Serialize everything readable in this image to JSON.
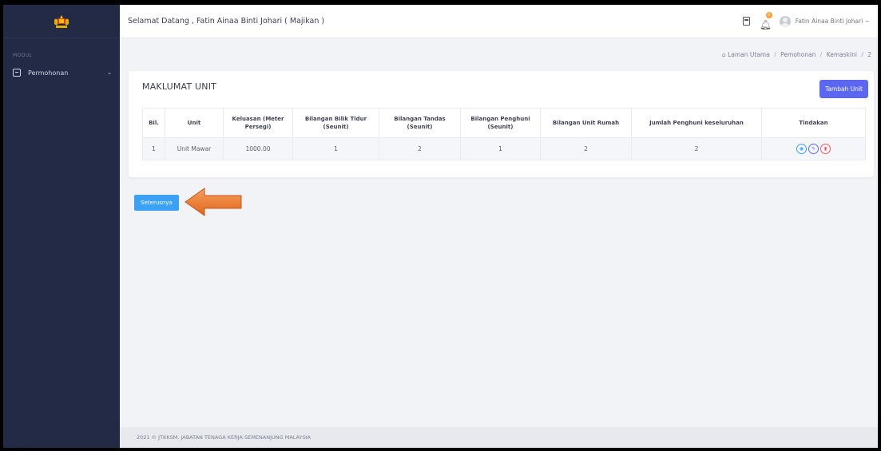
{
  "sidebar": {
    "section_label": "MODUL",
    "items": [
      {
        "label": "Permohonan",
        "icon": "clipboard-icon"
      }
    ]
  },
  "topbar": {
    "welcome": "Selamat Datang , Fatin Ainaa Binti Johari ( Majikan )",
    "notification_count": "0",
    "user_name": "Fatin Ainaa Binti Johari ~"
  },
  "breadcrumb": {
    "home": "Laman Utama",
    "level2": "Pemohonan",
    "level3": "Kemaskini",
    "level4": "2"
  },
  "card": {
    "title": "MAKLUMAT UNIT",
    "add_button": "Tambah Unit"
  },
  "table": {
    "headers": {
      "bil": "Bil.",
      "unit": "Unit",
      "keluasan": "Keluasan (Meter Persegi)",
      "bilik_tidur": "Bilangan Bilik Tidur (Seunit)",
      "tandas": "Bilangan Tandas (Seunit)",
      "penghuni": "Bilangan Penghuni (Seunit)",
      "unit_rumah": "Bilangan Unit Rumah",
      "jumlah": "Jumlah Penghuni keseluruhan",
      "tindakan": "Tindakan"
    },
    "rows": [
      {
        "bil": "1",
        "unit": "Unit Mawar",
        "keluasan": "1000.00",
        "bilik_tidur": "1",
        "tandas": "2",
        "penghuni": "1",
        "unit_rumah": "2",
        "jumlah": "2"
      }
    ]
  },
  "next_button": "Seterusnya",
  "footer": "2021 © JTKKSM. JABATAN TENAGA KERJA SEMENANJUNG MALAYSIA",
  "colors": {
    "sidebar_bg": "#222a45",
    "primary": "#5b67f0",
    "info": "#3ba1f5",
    "danger": "#f25a5a",
    "arrow": "#f07a2e"
  }
}
